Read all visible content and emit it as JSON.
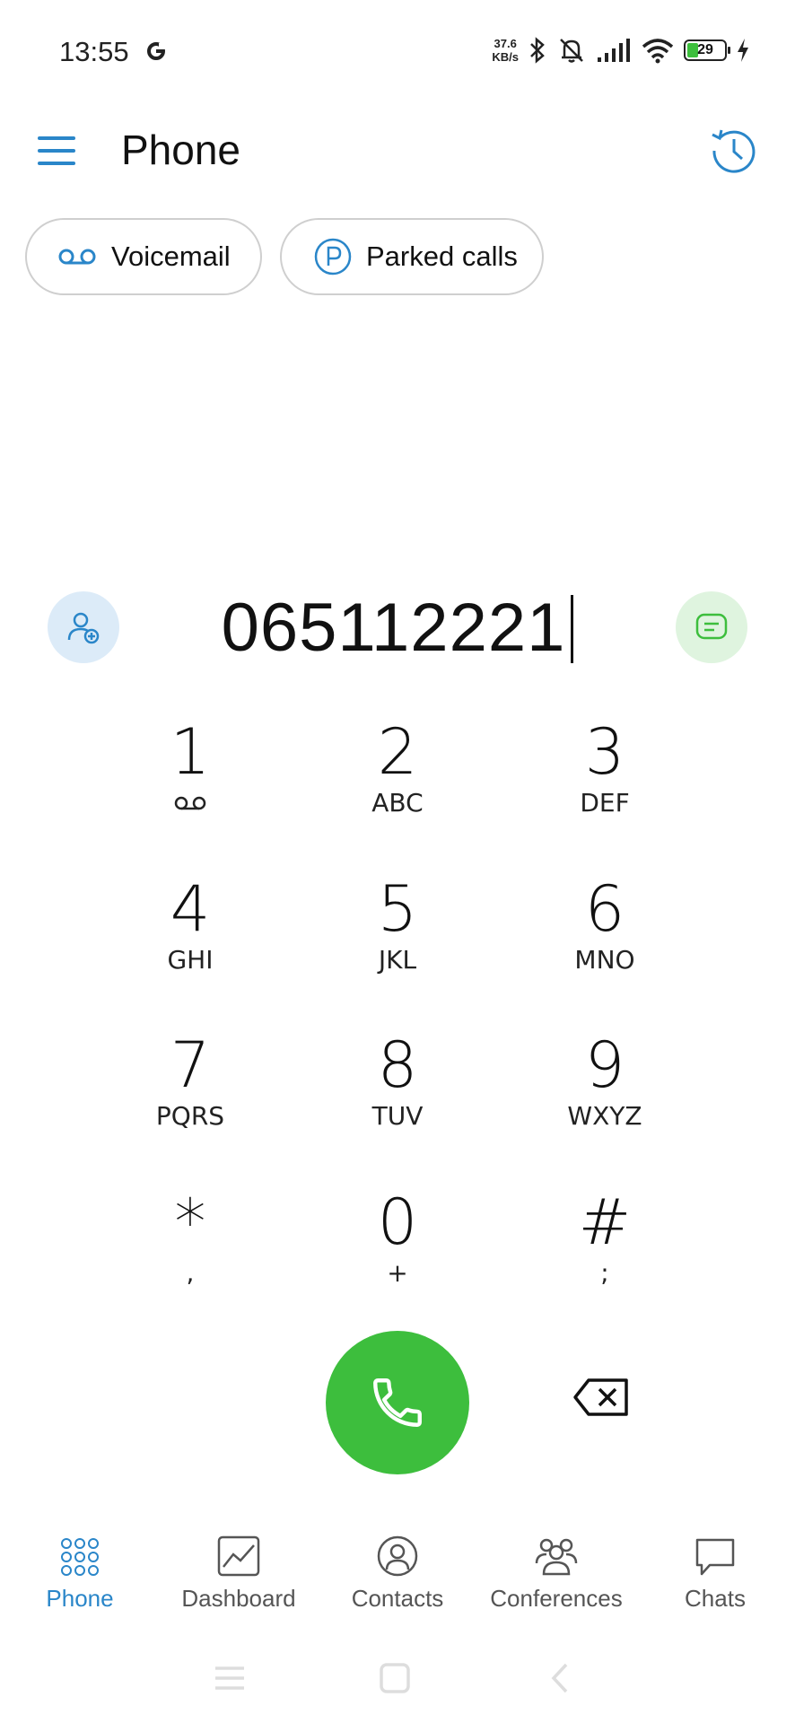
{
  "status_bar": {
    "time": "13:55",
    "net_speed_value": "37.6",
    "net_speed_unit": "KB/s",
    "battery": "29"
  },
  "header": {
    "title": "Phone"
  },
  "chips": {
    "voicemail": "Voicemail",
    "parked_calls": "Parked calls"
  },
  "dialer": {
    "number": "065112221"
  },
  "keypad": [
    {
      "digit": "1",
      "sub": ""
    },
    {
      "digit": "2",
      "sub": "ABC"
    },
    {
      "digit": "3",
      "sub": "DEF"
    },
    {
      "digit": "4",
      "sub": "GHI"
    },
    {
      "digit": "5",
      "sub": "JKL"
    },
    {
      "digit": "6",
      "sub": "MNO"
    },
    {
      "digit": "7",
      "sub": "PQRS"
    },
    {
      "digit": "8",
      "sub": "TUV"
    },
    {
      "digit": "9",
      "sub": "WXYZ"
    },
    {
      "digit": "*",
      "sub": ","
    },
    {
      "digit": "0",
      "sub": "+"
    },
    {
      "digit": "#",
      "sub": ";"
    }
  ],
  "bottom_nav": [
    {
      "label": "Phone",
      "icon": "keypad-grid-icon",
      "active": true
    },
    {
      "label": "Dashboard",
      "icon": "chart-icon",
      "active": false
    },
    {
      "label": "Contacts",
      "icon": "person-icon",
      "active": false
    },
    {
      "label": "Conferences",
      "icon": "group-icon",
      "active": false
    },
    {
      "label": "Chats",
      "icon": "chat-bubble-icon",
      "active": false
    }
  ],
  "colors": {
    "accent": "#2a86c9",
    "call_green": "#3dbe3d"
  }
}
